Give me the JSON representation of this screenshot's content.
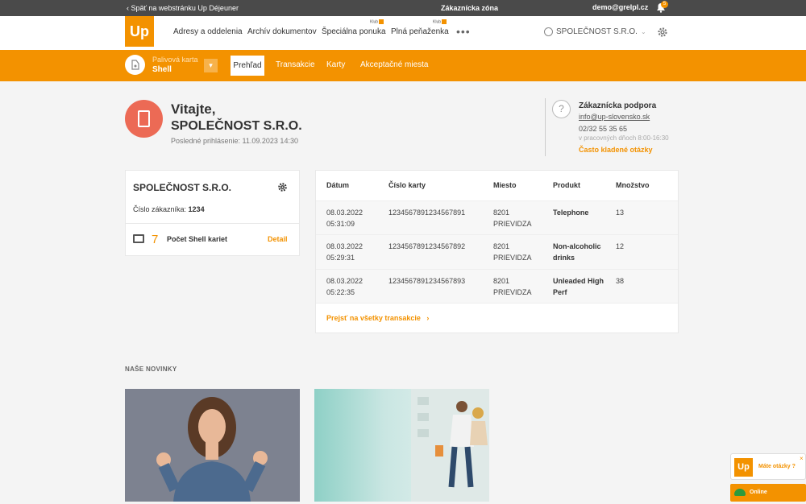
{
  "topbar": {
    "back": "‹ Späť na webstránku Up Déjeuner",
    "zone": "Zákaznícka zóna",
    "email": "demo@grelpl.cz",
    "bell_count": "5"
  },
  "header": {
    "logo": "Up",
    "nav": [
      "Adresy a oddelenia",
      "Archív dokumentov",
      "Špeciálna ponuka",
      "Plná peňaženka"
    ],
    "klub": "Klub",
    "more": "•••",
    "company": "SPOLEČNOST S.R.O."
  },
  "cardbar": {
    "type": "Palivová karta",
    "name": "Shell",
    "tabs": [
      "Prehľad",
      "Transakcie",
      "Karty",
      "Akceptačné miesta"
    ]
  },
  "welcome": {
    "greeting": "Vitajte,",
    "company": "SPOLEČNOST S.R.O.",
    "last_login": "Posledné prihlásenie: 11.09.2023 14:30"
  },
  "support": {
    "title": "Zákaznícka podpora",
    "email": "info@up-slovensko.sk",
    "phone": "02/32 55 35 65",
    "hours": "v pracovných dňoch 8:00-16:30",
    "faq": "Často kladené otázky"
  },
  "company_panel": {
    "title": "SPOLEČNOST S.R.O.",
    "customer_label": "Číslo zákazníka:",
    "customer_number": "1234",
    "cards_count": "7",
    "cards_label": "Počet Shell kariet",
    "detail": "Detail"
  },
  "transactions": {
    "headers": [
      "Dátum",
      "Číslo karty",
      "Miesto",
      "Produkt",
      "Množstvo"
    ],
    "rows": [
      {
        "date": "08.03.2022",
        "time": "05:31:09",
        "card": "1234567891234567891",
        "place1": "8201",
        "place2": "PRIEVIDZA",
        "product1": "Telephone",
        "product2": "",
        "qty": "13"
      },
      {
        "date": "08.03.2022",
        "time": "05:29:31",
        "card": "1234567891234567892",
        "place1": "8201",
        "place2": "PRIEVIDZA",
        "product1": "Non-alcoholic",
        "product2": "drinks",
        "qty": "12"
      },
      {
        "date": "08.03.2022",
        "time": "05:22:35",
        "card": "1234567891234567893",
        "place1": "8201",
        "place2": "PRIEVIDZA",
        "product1": "Unleaded High",
        "product2": "Perf",
        "qty": "38"
      }
    ],
    "all_link": "Prejsť na všetky transakcie"
  },
  "news": {
    "title": "NAŠE NOVINKY"
  },
  "chat": {
    "logo": "Up",
    "question": "Máte otázky ?",
    "close": "×",
    "online": "Online"
  },
  "colors": {
    "brand": "#f39200",
    "avatar": "#ec6a55",
    "topbar": "#4a4a4a"
  }
}
